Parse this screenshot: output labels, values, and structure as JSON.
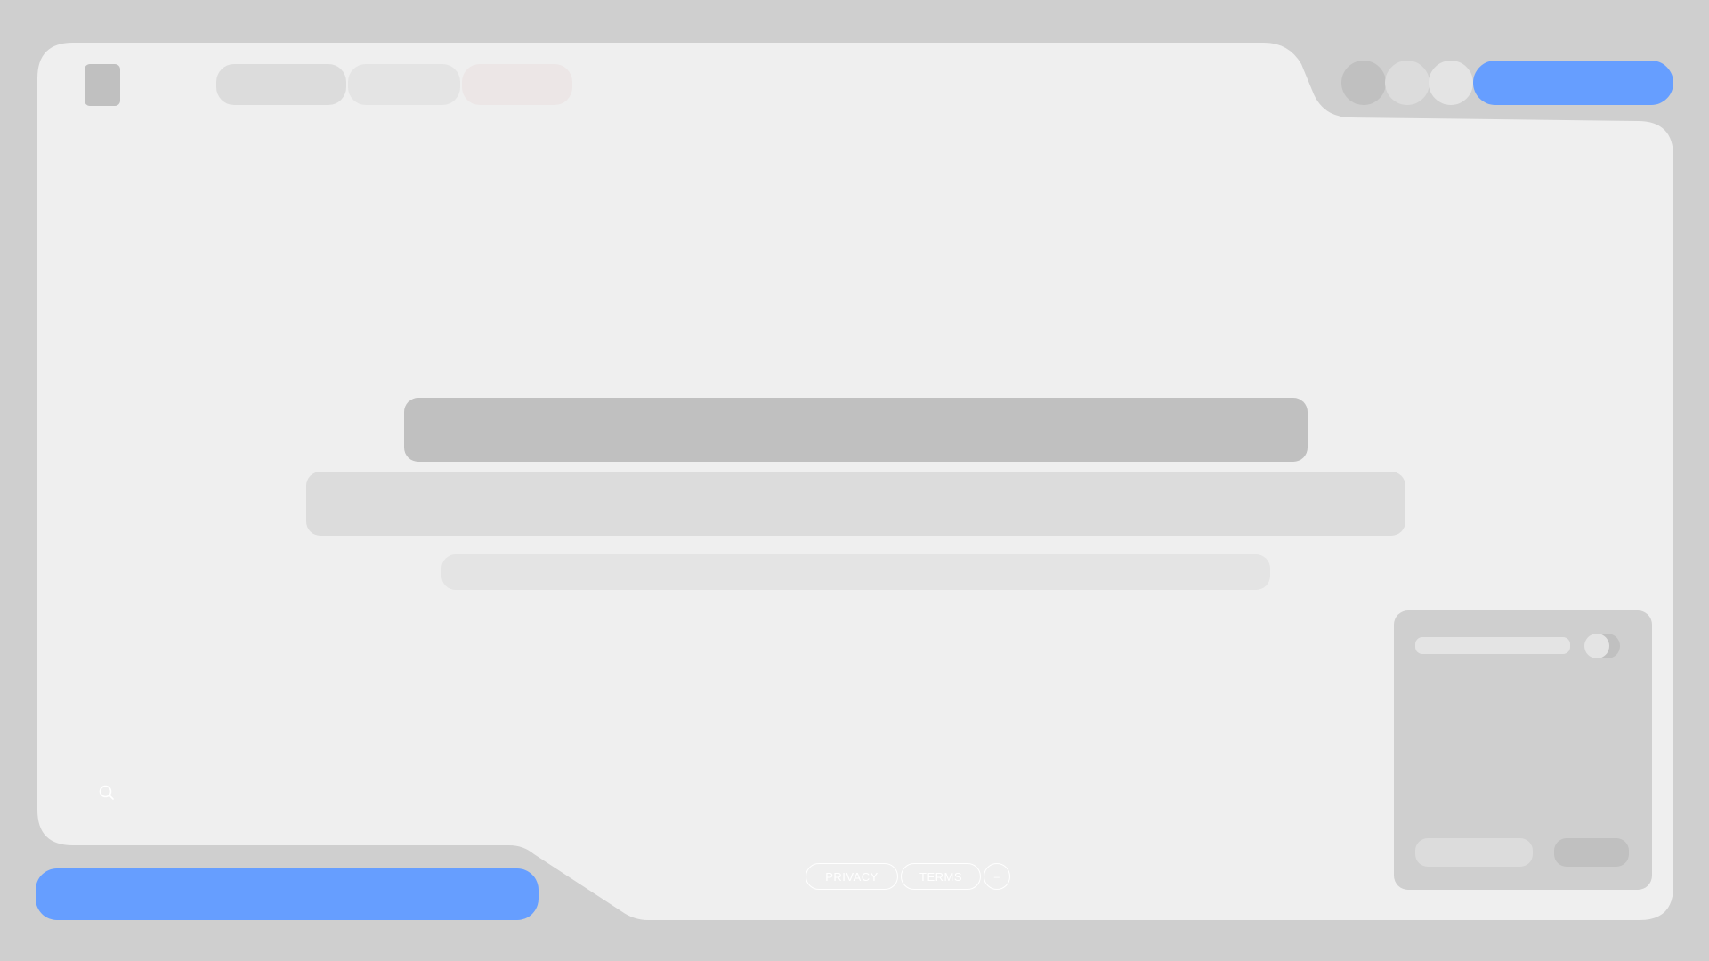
{
  "colors": {
    "background": "#cfcfcf",
    "panel": "#efefef",
    "accent": "#669eff",
    "skeleton_dark": "#c0c0c0",
    "skeleton_mid": "#dcdcdc",
    "skeleton_light": "#e4e4e4",
    "tab_tinted": "#ece6e6"
  },
  "header": {
    "logo_icon": "logo-square-icon",
    "tabs": [
      "",
      "",
      ""
    ],
    "avatars": [
      "",
      "",
      ""
    ],
    "primary_button_label": ""
  },
  "main": {
    "heading": "",
    "subheading": "",
    "caption": ""
  },
  "side_card": {
    "title": "",
    "toggle": "on",
    "secondary_button_label": "",
    "action_button_label": ""
  },
  "footer": {
    "search_icon": "search-icon",
    "cta_label": "",
    "links": {
      "privacy": "PRIVACY",
      "terms": "TERMS",
      "more": "–"
    }
  }
}
